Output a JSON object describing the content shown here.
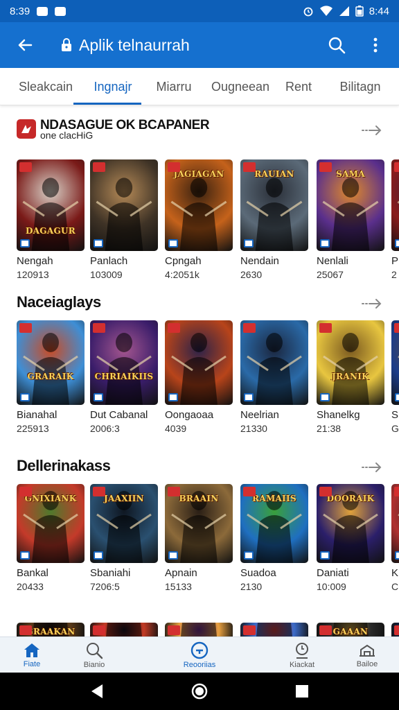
{
  "status_bar": {
    "time": "8:39",
    "right_time": "8:44"
  },
  "app_bar": {
    "title": "Aplik telnaurrah"
  },
  "tabs": [
    "Sleakcain",
    "Ingnajr",
    "Miarru",
    "Ougneean",
    "Rent",
    "Bilitagn"
  ],
  "active_tab": 1,
  "sections": [
    {
      "title": "NDASAGUE OK BCAPANER",
      "subtitle": "one clacHiG",
      "items": [
        {
          "name": "Nengah",
          "count": "120913",
          "banner": "DAGAGUR",
          "c1": "#7a1a18",
          "c2": "#d9d2c8"
        },
        {
          "name": "Panlach",
          "count": "103009",
          "banner": "",
          "c1": "#3f3326",
          "c2": "#b58a57"
        },
        {
          "name": "Cpngah",
          "count": "4:2051k",
          "banner": "JAGIAGAN",
          "c1": "#c5621b",
          "c2": "#3a2210"
        },
        {
          "name": "Nendain",
          "count": "2630",
          "banner": "RAUIAN",
          "c1": "#5b6a78",
          "c2": "#2a2f38"
        },
        {
          "name": "Nenlali",
          "count": "25067",
          "banner": "SAMA",
          "c1": "#5a2f8c",
          "c2": "#e08a2a"
        },
        {
          "name": "P",
          "count": "2",
          "banner": "",
          "c1": "#8a1c1c",
          "c2": "#2b1a3a"
        }
      ]
    },
    {
      "title": "Naceiaglays",
      "items": [
        {
          "name": "Bianahal",
          "count": "225913",
          "banner": "GRARAIK",
          "c1": "#3e8fd6",
          "c2": "#c94b24"
        },
        {
          "name": "Dut Cabanal",
          "count": "2006:3",
          "banner": "CHRIAIKIIS",
          "c1": "#3a1d6a",
          "c2": "#a4568f"
        },
        {
          "name": "Oongaoaa",
          "count": "4039",
          "banner": "",
          "c1": "#b8441a",
          "c2": "#2c2248"
        },
        {
          "name": "Neelrian",
          "count": "21330",
          "banner": "",
          "c1": "#2a6aa8",
          "c2": "#1b2740"
        },
        {
          "name": "Shanelkg",
          "count": "21:38",
          "banner": "JRANIK",
          "c1": "#e8c640",
          "c2": "#7b5a20"
        },
        {
          "name": "S",
          "count": "G",
          "banner": "",
          "c1": "#1c3d8a",
          "c2": "#6c4a2a"
        }
      ]
    },
    {
      "title": "Dellerinakass",
      "items": [
        {
          "name": "Bankal",
          "count": "20433",
          "banner": "GNIXIANK",
          "c1": "#c43a2a",
          "c2": "#4e7a2c"
        },
        {
          "name": "Sbaniahi",
          "count": "7206:5",
          "banner": "JAAXIIN",
          "c1": "#2a5070",
          "c2": "#0f1722"
        },
        {
          "name": "Apnain",
          "count": "15133",
          "banner": "BRAAIN",
          "c1": "#8c6a3a",
          "c2": "#2a1f16"
        },
        {
          "name": "Suadoa",
          "count": "2130",
          "banner": "RAMAIIS",
          "c1": "#1f6fc0",
          "c2": "#3aa03a"
        },
        {
          "name": "Daniati",
          "count": "10:009",
          "banner": "DOORAIK",
          "c1": "#2b1f6a",
          "c2": "#e0a23a"
        },
        {
          "name": "K",
          "count": "C",
          "banner": "",
          "c1": "#b03030",
          "c2": "#202020"
        }
      ]
    },
    {
      "title": "",
      "items": [
        {
          "name": "",
          "count": "",
          "banner": "GRAAKAN",
          "c1": "#5a3a1a",
          "c2": "#1a1010"
        },
        {
          "name": "",
          "count": "",
          "banner": "",
          "c1": "#c23a24",
          "c2": "#1a1020"
        },
        {
          "name": "",
          "count": "",
          "banner": "",
          "c1": "#e8a040",
          "c2": "#6a2a8a"
        },
        {
          "name": "",
          "count": "",
          "banner": "",
          "c1": "#3a6ac8",
          "c2": "#c83a3a"
        },
        {
          "name": "",
          "count": "",
          "banner": "GAAAN",
          "c1": "#2a2a2a",
          "c2": "#c8a040"
        },
        {
          "name": "",
          "count": "",
          "banner": "",
          "c1": "#1a2a5a",
          "c2": "#8a8a8a"
        }
      ]
    }
  ],
  "bottom_nav": [
    "Fiate",
    "Bianio",
    "Reooriias",
    "Kiackat",
    "Bailoe"
  ],
  "bottom_nav_active": 2,
  "colors": {
    "primary": "#1570cf",
    "status": "#0d5fb8",
    "accent": "#1565c0"
  }
}
